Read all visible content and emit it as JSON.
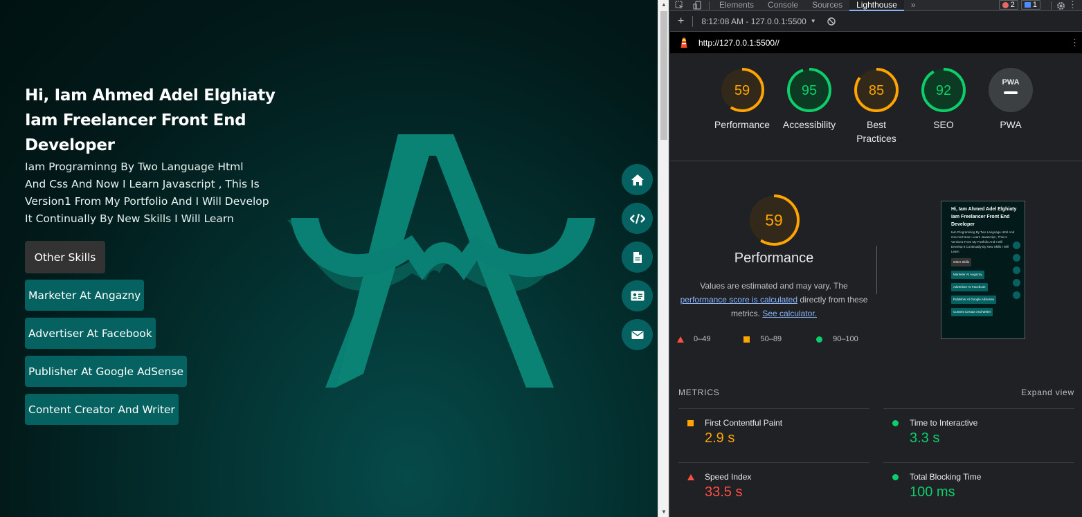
{
  "site": {
    "intro_title_lines": [
      "Hi, Iam Ahmed Adel Elghiaty",
      "Iam Freelancer Front End",
      "Developer"
    ],
    "intro_text_lines": [
      "Iam Programinng By Two Language Html",
      "And Css And Now I Learn Javascript , This Is",
      "Version1 From My Portfolio And I Will Develop",
      "It Continually By New Skills I Will Learn"
    ],
    "other_skills_button": "Other Skills",
    "skills": [
      "Marketer At Angazny",
      "Advertiser At Facebook",
      "Publisher At Google AdSense",
      "Content Creator And Writer"
    ],
    "nav_icons": [
      "home-icon",
      "code-icon",
      "file-icon",
      "id-card-icon",
      "envelope-icon"
    ],
    "accent_color": "#066161",
    "logo_color": "#0a7f73"
  },
  "devtools": {
    "tabs": [
      "Elements",
      "Console",
      "Sources",
      "Lighthouse"
    ],
    "active_tab": "Lighthouse",
    "more_tabs": "»",
    "error_count": "2",
    "message_count": "1",
    "report_selector": "8:12:08 AM - 127.0.0.1:5500",
    "url": "http://127.0.0.1:5500//",
    "categories": [
      {
        "label": "Performance",
        "score": "59",
        "status": "average"
      },
      {
        "label": "Accessibility",
        "score": "95",
        "status": "pass"
      },
      {
        "label": "Best Practices",
        "score": "85",
        "status": "average"
      },
      {
        "label": "SEO",
        "score": "92",
        "status": "pass"
      },
      {
        "label": "PWA",
        "score": "PWA",
        "status": "na"
      }
    ],
    "perf": {
      "score": "59",
      "title": "Performance",
      "note_1": "Values are estimated and may vary. The",
      "note_link_1": "performance score is calculated",
      "note_2": " directly from these metrics.",
      "note_link_2": "See calculator."
    },
    "legend": [
      {
        "range": "0–49",
        "color": "#ff4e42"
      },
      {
        "range": "50–89",
        "color": "#ffa400"
      },
      {
        "range": "90–100",
        "color": "#0cce6b"
      }
    ],
    "metrics_label": "METRICS",
    "expand_view": "Expand view",
    "metrics": [
      {
        "name": "First Contentful Paint",
        "value": "2.9 s",
        "status": "average"
      },
      {
        "name": "Time to Interactive",
        "value": "3.3 s",
        "status": "pass"
      },
      {
        "name": "Speed Index",
        "value": "33.5 s",
        "status": "fail"
      },
      {
        "name": "Total Blocking Time",
        "value": "100 ms",
        "status": "pass"
      }
    ],
    "colors": {
      "pass": "#0cce6b",
      "average": "#ffa400",
      "fail": "#ff4e42"
    }
  }
}
